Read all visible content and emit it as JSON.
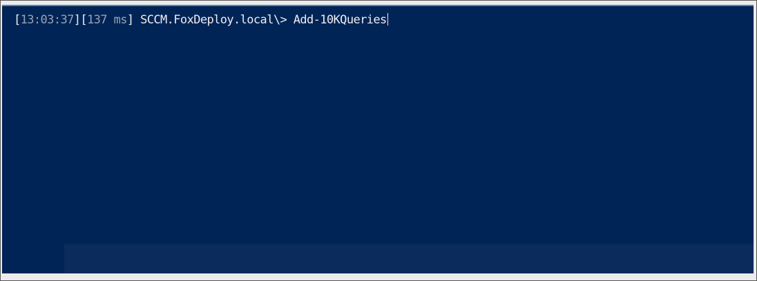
{
  "prompt": {
    "time": "13:03:37",
    "duration_value": "137",
    "duration_unit": "ms",
    "location": "SCCM.FoxDeploy.local\\>",
    "command": "Add-10KQueries"
  },
  "colors": {
    "background": "#012456",
    "text": "#eeedf0"
  }
}
